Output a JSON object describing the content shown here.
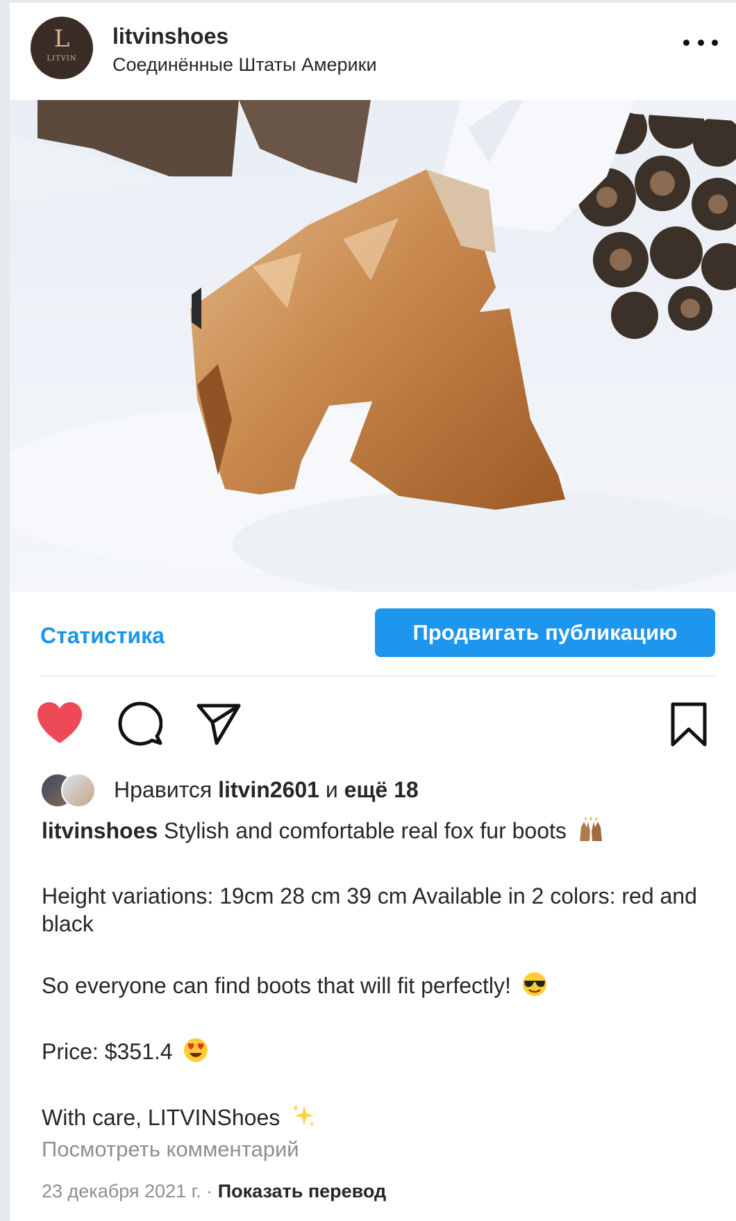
{
  "header": {
    "avatar_monogram": "L",
    "avatar_brand": "LITVIN",
    "username": "litvinshoes",
    "location": "Соединённые Штаты Америки",
    "more_icon": "more-horizontal-icon"
  },
  "photo": {
    "subject": "fox fur boots in snow"
  },
  "actions": {
    "statistics_label": "Статистика",
    "promote_label": "Продвигать публикацию",
    "promote_color": "#1e96ed",
    "link_color": "#1a95e8",
    "like_color": "#ed4956"
  },
  "icons": {
    "like": "heart-icon",
    "comment": "comment-icon",
    "share": "send-icon",
    "save": "bookmark-icon"
  },
  "likes": {
    "prefix": "Нравится",
    "user": "litvin2601",
    "and": "и",
    "others": "ещё 18"
  },
  "caption": {
    "author": "litvinshoes",
    "line1": "Stylish and comfortable real fox fur boots",
    "line2": "Height variations: 19cm 28 cm 39 cm Available in 2 colors: red and black",
    "line3": "So everyone can find boots that will fit perfectly!",
    "line4": "Price: $351.4",
    "line5": "With care, LITVINShoes"
  },
  "view_comments": "Посмотреть комментарий",
  "meta": {
    "date": "23 декабря 2021 г.",
    "separator": "·",
    "translate": "Показать перевод"
  }
}
